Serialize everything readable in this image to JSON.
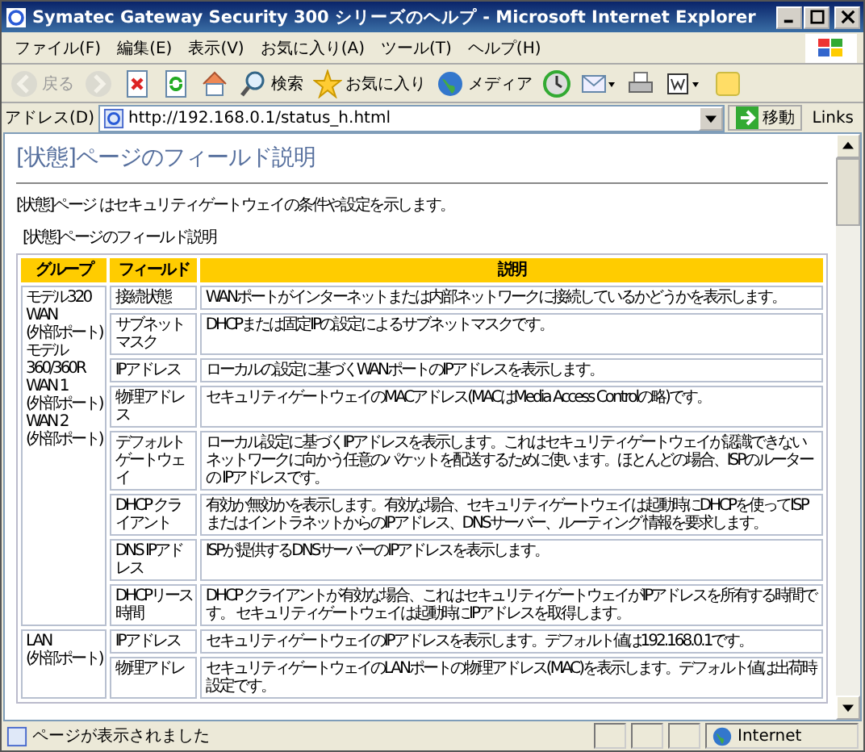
{
  "window": {
    "title": "Symatec Gateway Security 300 シリーズのヘルプ - Microsoft Internet Explorer"
  },
  "menu": [
    "ファイル(F)",
    "編集(E)",
    "表示(V)",
    "お気に入り(A)",
    "ツール(T)",
    "ヘルプ(H)"
  ],
  "toolbar": [
    {
      "kind": "back",
      "label": "戻る",
      "disabled": true
    },
    {
      "kind": "forward",
      "disabled": true
    },
    {
      "kind": "stop",
      "disabled": false
    },
    {
      "kind": "refresh",
      "disabled": false
    },
    {
      "kind": "home",
      "disabled": false
    },
    {
      "kind": "search",
      "label": "検索",
      "disabled": false
    },
    {
      "kind": "favorites",
      "label": "お気に入り",
      "disabled": false
    },
    {
      "kind": "media",
      "label": "メディア",
      "disabled": false
    },
    {
      "kind": "history",
      "disabled": false
    },
    {
      "kind": "mail",
      "disabled": false
    },
    {
      "kind": "print",
      "disabled": false
    },
    {
      "kind": "edit",
      "disabled": false
    },
    {
      "kind": "note",
      "disabled": false
    }
  ],
  "address_bar": {
    "label": "アドレス(D)",
    "value": "http://192.168.0.1/status_h.html",
    "go": "移動",
    "links": "Links"
  },
  "page": {
    "heading": "[状態]ページのフィールド説明",
    "intro": "[状態]ページ はセキュリティゲートウェイの条件や設定を示します。",
    "caption": "[状態]ページのフィールド説明",
    "table": {
      "columns": [
        "グループ",
        "フィールド",
        "説明"
      ],
      "groups": [
        {
          "label": [
            "モデル320",
            "WAN",
            "(外部ポート)",
            "モデル",
            "360/360R",
            "WAN 1",
            "(外部ポート)",
            "WAN 2",
            "(外部ポート)"
          ],
          "rows": [
            {
              "field": "接続状態",
              "description": "WANポートがインターネットまたは内部ネットワークに接続しているかどうかを表示します。"
            },
            {
              "field": "サブネットマスク",
              "description": "DHCPまたは固定IPの設定によるサブネットマスクです。"
            },
            {
              "field": "IPアドレス",
              "description": "ローカルの設定に基づくWANポートのIPアドレスを表示します。"
            },
            {
              "field": "物理アドレス",
              "description": "セキュリティゲートウェイのMACアドレス(MACはMedia Access Controlの略)です。"
            },
            {
              "field": "デフォルトゲートウェイ",
              "description": "ローカル設定に基づくIPアドレスを表示します。これはセキュリティゲートウェイが認識できないネットワークに向かう任意のパケットを配送するために使います。ほとんどの場合、ISPのルーターの IPアドレスです。"
            },
            {
              "field": "DHCP クライアント",
              "description": "有効か無効かを表示します。有効な場合、セキュリティゲートウェイは起動時にDHCPを使ってISPまたはイントラネットからのIPアドレス、DNSサーバー、ルーティング 情報を要求します。"
            },
            {
              "field": "DNS IPアドレス",
              "description": "ISPが提供するDNSサーバーのIPアドレスを表示します。"
            },
            {
              "field": "DHCPリース時間",
              "description": "DHCP クライアントが有効な場合、これはセキュリティゲートウェイがIPアドレスを所有する時間です。 セキュリティゲートウェイは起動時にIPアドレスを取得します。"
            }
          ]
        },
        {
          "label": [
            "LAN",
            "(外部ポート)"
          ],
          "rows": [
            {
              "field": "IPアドレス",
              "description": "セキュリティゲートウェイのIPアドレスを表示します。デフォルト値は192.168.0.1です。"
            },
            {
              "field": "物理アドレ",
              "description": "セキュリティゲートウェイのLANポートの物理アドレス(MAC)を表示します。デフォルト値は出荷時設定です。"
            }
          ]
        }
      ]
    }
  },
  "status_bar": {
    "text": "ページが表示されました",
    "zone": "Internet"
  }
}
